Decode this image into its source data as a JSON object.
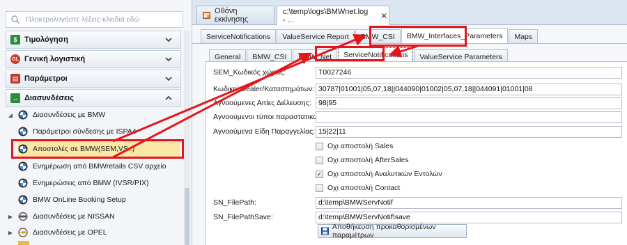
{
  "sidebar": {
    "search_placeholder": "Πληκτρολογήστε λέξεις-κλειδιά εδώ",
    "groups": [
      {
        "label": "Τιμολόγηση",
        "icon": "invoice-icon",
        "color": "#2e8b3a"
      },
      {
        "label": "Γενική λογιστική",
        "icon": "gl-icon",
        "badge": "GL",
        "color": "#d23a2a"
      },
      {
        "label": "Παράμετροι",
        "icon": "parameters-icon",
        "color": "#c0392b"
      },
      {
        "label": "Διασυνδέσεις",
        "icon": "integrations-icon",
        "color": "#2e8b3a"
      }
    ],
    "tree": [
      {
        "label": "Διασυνδέσεις με BMW",
        "icon": "bmw-logo-icon",
        "expanded": true
      },
      {
        "label": "Παράμετροι σύνδεσης με ISPA4",
        "icon": "bmw-logo-icon"
      },
      {
        "label": "Αποστολές  σε BMW(SEM,VS..)",
        "icon": "bmw-logo-icon",
        "highlighted": true
      },
      {
        "label": "Ενημέρωση από BMWretails CSV αρχείο",
        "icon": "bmw-logo-icon"
      },
      {
        "label": "Ενημερώσεις από BMW (IVSR/PIX)",
        "icon": "bmw-logo-icon"
      },
      {
        "label": "BMW OnLine Booking Setup",
        "icon": "bmw-logo-icon"
      },
      {
        "label": "Διασυνδέσεις με NISSAN",
        "icon": "nissan-logo-icon",
        "expanded": false
      },
      {
        "label": "Διασυνδέσεις με OPEL",
        "icon": "opel-logo-icon",
        "expanded": false
      }
    ]
  },
  "doc_tabs": [
    {
      "label": "Οθόνη εκκίνησης",
      "icon": "home-screen-icon"
    },
    {
      "label": "c:\\temp\\logs\\BMWnet.log - ...",
      "close": "✕"
    }
  ],
  "top_tabs": [
    "ServiceNotifications",
    "ValueService Report",
    "BMW_CSI",
    "BMW_Interfaces_Parameters",
    "Maps"
  ],
  "sub_tabs": [
    "General",
    "BMW_CSI",
    "BMW_Net",
    "ServiceNotifications",
    "ValueService Parameters"
  ],
  "form": {
    "fields": [
      {
        "label": "SEM_Κωδικός χώρας:",
        "value": "T0027246"
      },
      {
        "label": "Κωδικοί Dealer/Καταστημάτων:",
        "value": "30787|01001|05,07,18||044090|01002|05,07,18||044091|01001|08"
      },
      {
        "label": "Αγνοούμενες Αιτίες Διέλευσης:",
        "value": "98|95"
      },
      {
        "label": "Αγνοούμενοι τύποι παραστατικών:",
        "value": ""
      },
      {
        "label": "Αγνοούμενα Είδη Παραγγελίας:",
        "value": "15|22|11"
      }
    ],
    "checkboxes": [
      {
        "label": "Οχι αποστολή Sales",
        "checked": false
      },
      {
        "label": "Οχι αποστολή AfterSales",
        "checked": false
      },
      {
        "label": "Οχι αποστολή Αναλυτικών Εντολών",
        "checked": true
      },
      {
        "label": "Οχι αποστολή Contact",
        "checked": false
      }
    ],
    "paths": [
      {
        "label": "SN_FilePath:",
        "value": "d:\\temp\\BMWServNotif"
      },
      {
        "label": "SN_FilePathSave:",
        "value": "d:\\temp\\BMWServNotif\\save"
      }
    ],
    "save_button": "Αποθήκευση προκαθορισμένων παραμέτρων"
  },
  "colors": {
    "annotation": "#e4161c",
    "accent": "#2e8b3a"
  }
}
